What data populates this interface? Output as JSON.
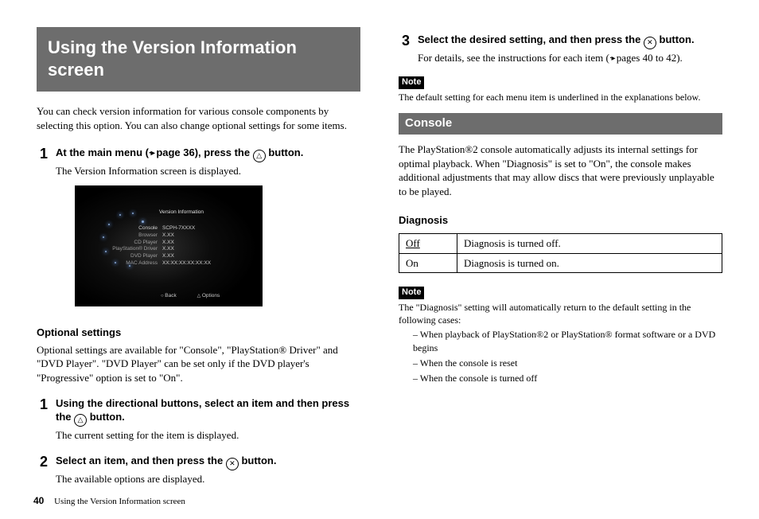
{
  "left": {
    "title": "Using the Version Information screen",
    "intro": "You can check version information for various console components by selecting this option. You can also change optional settings for some items.",
    "step1_pre": "At the main menu (",
    "step1_mid": " page 36), press the ",
    "step1_post": " button.",
    "step1_desc": "The Version Information screen is displayed.",
    "shot": {
      "title": "Version Information",
      "rows": [
        {
          "label": "Console",
          "value": "SCPH-7XXXX"
        },
        {
          "label": "Browser",
          "value": "X.XX"
        },
        {
          "label": "CD Player",
          "value": "X.XX"
        },
        {
          "label": "PlayStation® Driver",
          "value": "X.XX"
        },
        {
          "label": "DVD Player",
          "value": "X.XX"
        },
        {
          "label": "MAC Address",
          "value": "XX:XX:XX:XX:XX:XX"
        }
      ],
      "back": "Back",
      "options": "Options"
    },
    "opt_head": "Optional settings",
    "opt_body": "Optional settings are available for \"Console\", \"PlayStation® Driver\" and \"DVD Player\". \"DVD Player\" can be set only if the DVD player's \"Progressive\" option is set to \"On\".",
    "s1_pre": "Using the directional buttons, select an item and then press the ",
    "s1_post": " button.",
    "s1_desc": "The current setting for the item is displayed.",
    "s2_pre": "Select an item, and then press the ",
    "s2_post": " button.",
    "s2_desc": "The available options are displayed."
  },
  "right": {
    "s3_pre": "Select the desired setting, and then press the ",
    "s3_post": " button.",
    "s3_desc_pre": "For details, see the instructions for each item (",
    "s3_desc_post": " pages 40 to 42).",
    "note_label": "Note",
    "note1": "The default setting for each menu item is underlined in the explanations below.",
    "section": "Console",
    "console_body": "The PlayStation®2 console automatically adjusts its internal settings for optimal playback. When \"Diagnosis\" is set to \"On\", the console makes additional adjustments that may allow discs that were previously unplayable to be played.",
    "diag_head": "Diagnosis",
    "diag": [
      {
        "key": "Off",
        "val": "Diagnosis is turned off.",
        "u": true
      },
      {
        "key": "On",
        "val": "Diagnosis is turned on.",
        "u": false
      }
    ],
    "note2_lead": "The \"Diagnosis\" setting will automatically return to the default setting in the following cases:",
    "note2_items": [
      "When playback of PlayStation®2 or PlayStation® format software or a DVD begins",
      "When the console is reset",
      "When the console is turned off"
    ]
  },
  "footer": {
    "page": "40",
    "title": "Using the Version Information screen"
  }
}
